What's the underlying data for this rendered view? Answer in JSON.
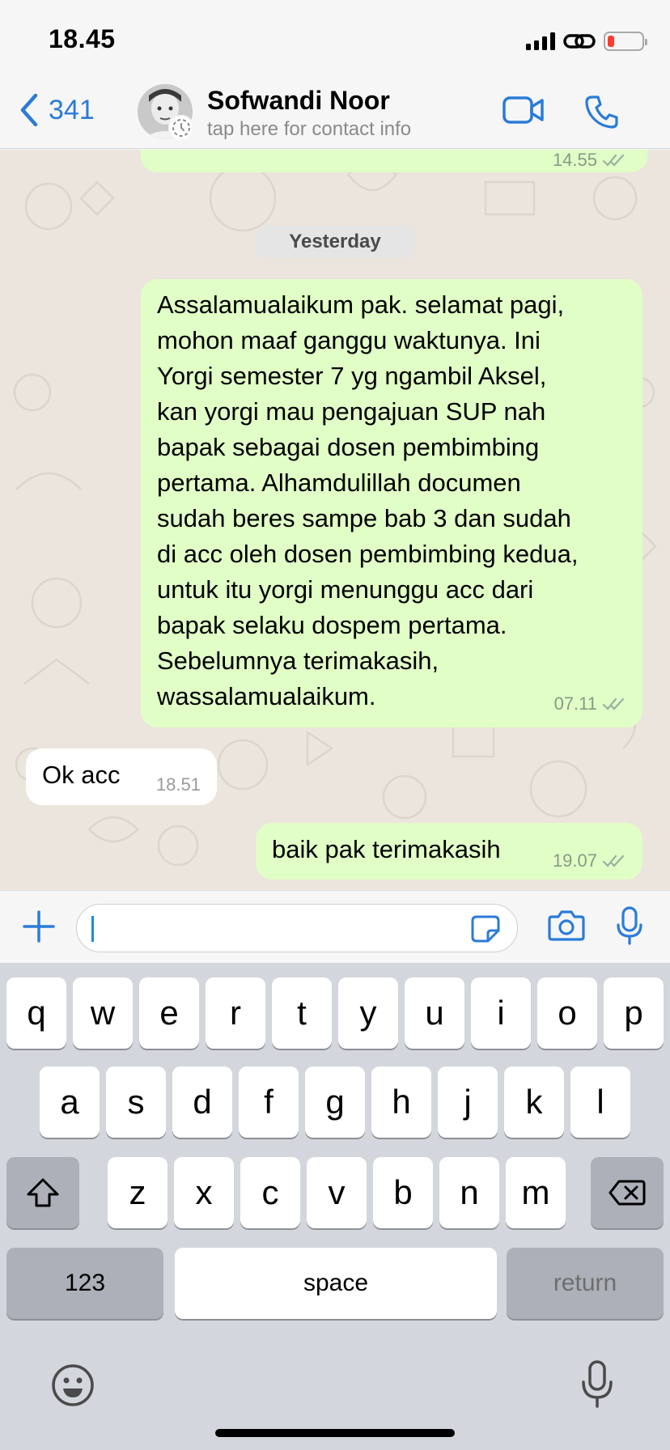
{
  "status_bar": {
    "time": "18.45",
    "battery_level": 0.18,
    "battery_color": "#ff3b30"
  },
  "header": {
    "back_count": "341",
    "contact_name": "Sofwandi Noor",
    "contact_subtitle": "tap here for contact info",
    "accent": "#2b7bd8"
  },
  "chat": {
    "previous_time": "14.55",
    "date_separator": "Yesterday",
    "messages": [
      {
        "direction": "outgoing",
        "text": "Assalamualaikum pak. selamat pagi,\nmohon maaf ganggu waktunya. Ini\nYorgi semester 7 yg ngambil Aksel,\nkan yorgi mau pengajuan SUP nah\nbapak sebagai dosen pembimbing\npertama. Alhamdulillah documen\nsudah beres sampe bab 3 dan sudah\ndi acc oleh dosen pembimbing kedua,\nuntuk itu yorgi menunggu acc dari\nbapak selaku dospem pertama.\nSebelumnya terimakasih,\nwassalamualaikum.",
        "time": "07.11"
      },
      {
        "direction": "incoming",
        "text": "Ok acc",
        "time": "18.51"
      },
      {
        "direction": "outgoing",
        "text": "baik pak terimakasih",
        "time": "19.07"
      }
    ],
    "outgoing_color": "#e1fec6",
    "incoming_color": "#ffffff",
    "background_color": "#ebe5dd"
  },
  "input": {
    "value": "",
    "placeholder": ""
  },
  "keyboard": {
    "row1": [
      "q",
      "w",
      "e",
      "r",
      "t",
      "y",
      "u",
      "i",
      "o",
      "p"
    ],
    "row2": [
      "a",
      "s",
      "d",
      "f",
      "g",
      "h",
      "j",
      "k",
      "l"
    ],
    "row3": [
      "z",
      "x",
      "c",
      "v",
      "b",
      "n",
      "m"
    ],
    "numbers_label": "123",
    "space_label": "space",
    "return_label": "return"
  },
  "icons": {
    "back": "chevron-left-icon",
    "video": "video-camera-icon",
    "call": "phone-icon",
    "attach": "plus-icon",
    "sticker": "sticker-icon",
    "camera": "camera-icon",
    "mic": "microphone-icon",
    "shift": "shift-icon",
    "delete": "backspace-icon",
    "emoji": "emoji-icon",
    "dictation": "dictation-mic-icon"
  }
}
